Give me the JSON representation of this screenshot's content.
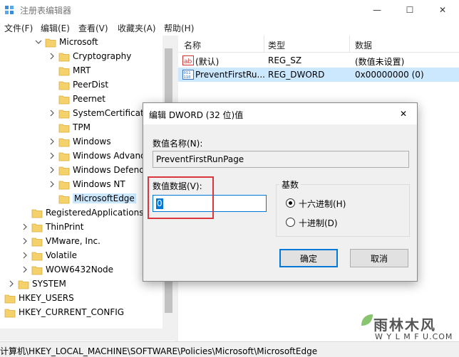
{
  "window": {
    "title": "注册表编辑器",
    "minimize_glyph": "—",
    "maximize_glyph": "☐",
    "close_glyph": "✕"
  },
  "menu": [
    "文件(F)",
    "编辑(E)",
    "查看(V)",
    "收藏夹(A)",
    "帮助(H)"
  ],
  "tree": [
    {
      "label": "Microsoft",
      "depth": 3,
      "expander": "expanded"
    },
    {
      "label": "Cryptography",
      "depth": 4,
      "expander": "collapsed"
    },
    {
      "label": "MRT",
      "depth": 4,
      "expander": "none"
    },
    {
      "label": "PeerDist",
      "depth": 4,
      "expander": "none"
    },
    {
      "label": "Peernet",
      "depth": 4,
      "expander": "none"
    },
    {
      "label": "SystemCertificates",
      "depth": 4,
      "expander": "collapsed"
    },
    {
      "label": "TPM",
      "depth": 4,
      "expander": "none"
    },
    {
      "label": "Windows",
      "depth": 4,
      "expander": "collapsed"
    },
    {
      "label": "Windows Advanced",
      "depth": 4,
      "expander": "collapsed"
    },
    {
      "label": "Windows Defender",
      "depth": 4,
      "expander": "collapsed"
    },
    {
      "label": "Windows NT",
      "depth": 4,
      "expander": "collapsed"
    },
    {
      "label": "MicrosoftEdge",
      "depth": 4,
      "expander": "none",
      "selected": true
    },
    {
      "label": "RegisteredApplications",
      "depth": 2,
      "expander": "none"
    },
    {
      "label": "ThinPrint",
      "depth": 2,
      "expander": "collapsed"
    },
    {
      "label": "VMware, Inc.",
      "depth": 2,
      "expander": "collapsed"
    },
    {
      "label": "Volatile",
      "depth": 2,
      "expander": "collapsed"
    },
    {
      "label": "WOW6432Node",
      "depth": 2,
      "expander": "collapsed"
    },
    {
      "label": "SYSTEM",
      "depth": 1,
      "expander": "collapsed"
    },
    {
      "label": "HKEY_USERS",
      "depth": 0,
      "expander": "collapsed"
    },
    {
      "label": "HKEY_CURRENT_CONFIG",
      "depth": 0,
      "expander": "collapsed"
    }
  ],
  "list": {
    "headers": [
      "名称",
      "类型",
      "数据"
    ],
    "rows": [
      {
        "icon": "string-value-icon",
        "name": "(默认)",
        "type": "REG_SZ",
        "data": "(数值未设置)",
        "selected": false
      },
      {
        "icon": "dword-value-icon",
        "name": "PreventFirstRu...",
        "type": "REG_DWORD",
        "data": "0x00000000 (0)",
        "selected": true
      }
    ]
  },
  "status": {
    "path": "计算机\\HKEY_LOCAL_MACHINE\\SOFTWARE\\Policies\\Microsoft\\MicrosoftEdge"
  },
  "dialog": {
    "title": "编辑 DWORD (32 位)值",
    "name_label": "数值名称(N):",
    "name_value": "PreventFirstRunPage",
    "data_label": "数值数据(V):",
    "data_value": "0",
    "base_group_title": "基数",
    "base_options": [
      {
        "label": "十六进制(H)",
        "checked": true
      },
      {
        "label": "十进制(D)",
        "checked": false
      }
    ],
    "ok_label": "确定",
    "cancel_label": "取消",
    "close_glyph": "✕"
  },
  "watermark": {
    "text_cn": "雨林木风",
    "url": "W Y L M F U.COM"
  },
  "colors": {
    "selection": "#cce8ff",
    "accent": "#0078d7",
    "highlight_red": "#d9363e",
    "folder": "#f5d16b"
  }
}
